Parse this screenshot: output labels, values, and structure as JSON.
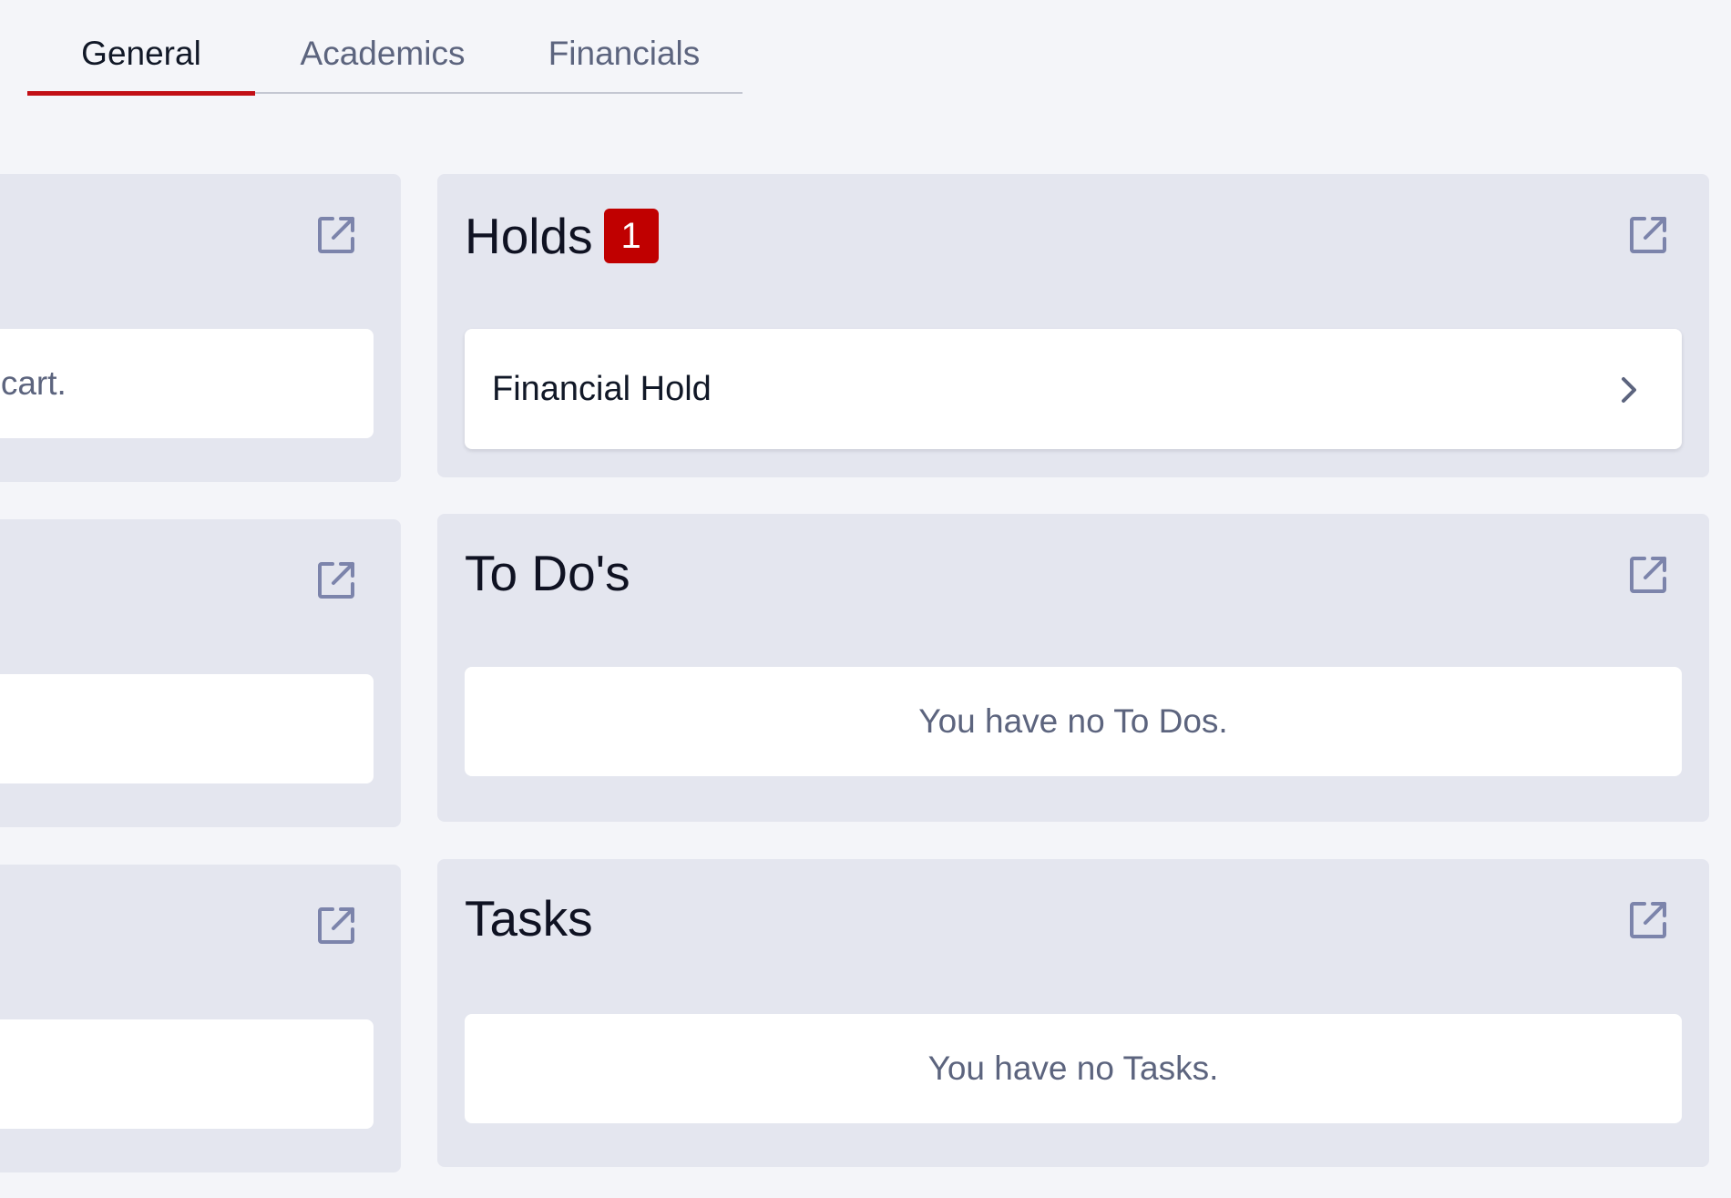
{
  "tabs": [
    {
      "label": "General"
    },
    {
      "label": "Academics"
    },
    {
      "label": "Financials"
    }
  ],
  "left_column": {
    "card1_text": "g cart.",
    "card2_text": "."
  },
  "holds": {
    "title": "Holds",
    "count": "1",
    "items": [
      {
        "label": "Financial Hold"
      }
    ]
  },
  "todos": {
    "title": "To Do's",
    "empty_text": "You have no To Dos."
  },
  "tasks": {
    "title": "Tasks",
    "empty_text": "You have no Tasks."
  },
  "icons": {
    "expand": "open-in-new-icon",
    "chevron": "chevron-right-icon"
  },
  "colors": {
    "accent": "#c20f16",
    "badge": "#c00000",
    "icon": "#7c84ab",
    "card_bg": "#e4e6ef",
    "page_bg": "#f4f5f9"
  }
}
